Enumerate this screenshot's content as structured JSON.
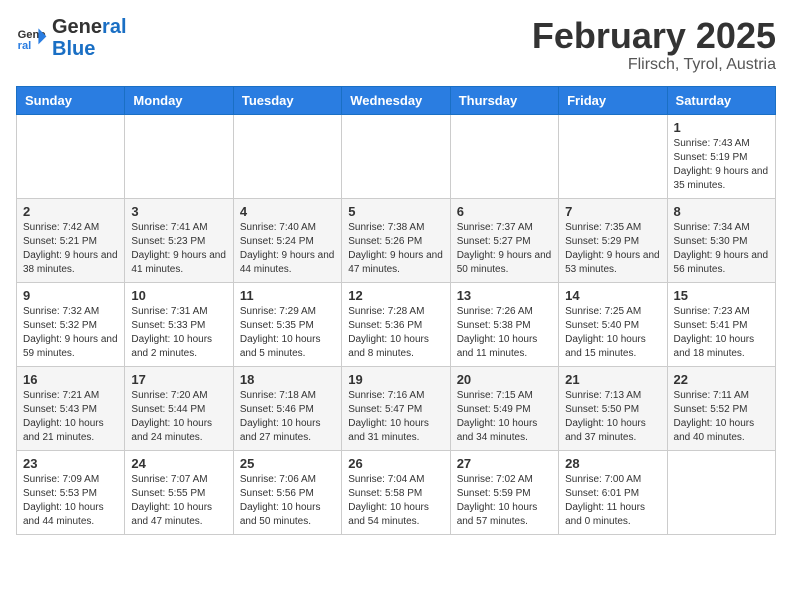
{
  "header": {
    "logo_line1": "General",
    "logo_line2": "Blue",
    "month_title": "February 2025",
    "location": "Flirsch, Tyrol, Austria"
  },
  "days_of_week": [
    "Sunday",
    "Monday",
    "Tuesday",
    "Wednesday",
    "Thursday",
    "Friday",
    "Saturday"
  ],
  "weeks": [
    [
      {
        "day": "",
        "detail": ""
      },
      {
        "day": "",
        "detail": ""
      },
      {
        "day": "",
        "detail": ""
      },
      {
        "day": "",
        "detail": ""
      },
      {
        "day": "",
        "detail": ""
      },
      {
        "day": "",
        "detail": ""
      },
      {
        "day": "1",
        "detail": "Sunrise: 7:43 AM\nSunset: 5:19 PM\nDaylight: 9 hours and 35 minutes."
      }
    ],
    [
      {
        "day": "2",
        "detail": "Sunrise: 7:42 AM\nSunset: 5:21 PM\nDaylight: 9 hours and 38 minutes."
      },
      {
        "day": "3",
        "detail": "Sunrise: 7:41 AM\nSunset: 5:23 PM\nDaylight: 9 hours and 41 minutes."
      },
      {
        "day": "4",
        "detail": "Sunrise: 7:40 AM\nSunset: 5:24 PM\nDaylight: 9 hours and 44 minutes."
      },
      {
        "day": "5",
        "detail": "Sunrise: 7:38 AM\nSunset: 5:26 PM\nDaylight: 9 hours and 47 minutes."
      },
      {
        "day": "6",
        "detail": "Sunrise: 7:37 AM\nSunset: 5:27 PM\nDaylight: 9 hours and 50 minutes."
      },
      {
        "day": "7",
        "detail": "Sunrise: 7:35 AM\nSunset: 5:29 PM\nDaylight: 9 hours and 53 minutes."
      },
      {
        "day": "8",
        "detail": "Sunrise: 7:34 AM\nSunset: 5:30 PM\nDaylight: 9 hours and 56 minutes."
      }
    ],
    [
      {
        "day": "9",
        "detail": "Sunrise: 7:32 AM\nSunset: 5:32 PM\nDaylight: 9 hours and 59 minutes."
      },
      {
        "day": "10",
        "detail": "Sunrise: 7:31 AM\nSunset: 5:33 PM\nDaylight: 10 hours and 2 minutes."
      },
      {
        "day": "11",
        "detail": "Sunrise: 7:29 AM\nSunset: 5:35 PM\nDaylight: 10 hours and 5 minutes."
      },
      {
        "day": "12",
        "detail": "Sunrise: 7:28 AM\nSunset: 5:36 PM\nDaylight: 10 hours and 8 minutes."
      },
      {
        "day": "13",
        "detail": "Sunrise: 7:26 AM\nSunset: 5:38 PM\nDaylight: 10 hours and 11 minutes."
      },
      {
        "day": "14",
        "detail": "Sunrise: 7:25 AM\nSunset: 5:40 PM\nDaylight: 10 hours and 15 minutes."
      },
      {
        "day": "15",
        "detail": "Sunrise: 7:23 AM\nSunset: 5:41 PM\nDaylight: 10 hours and 18 minutes."
      }
    ],
    [
      {
        "day": "16",
        "detail": "Sunrise: 7:21 AM\nSunset: 5:43 PM\nDaylight: 10 hours and 21 minutes."
      },
      {
        "day": "17",
        "detail": "Sunrise: 7:20 AM\nSunset: 5:44 PM\nDaylight: 10 hours and 24 minutes."
      },
      {
        "day": "18",
        "detail": "Sunrise: 7:18 AM\nSunset: 5:46 PM\nDaylight: 10 hours and 27 minutes."
      },
      {
        "day": "19",
        "detail": "Sunrise: 7:16 AM\nSunset: 5:47 PM\nDaylight: 10 hours and 31 minutes."
      },
      {
        "day": "20",
        "detail": "Sunrise: 7:15 AM\nSunset: 5:49 PM\nDaylight: 10 hours and 34 minutes."
      },
      {
        "day": "21",
        "detail": "Sunrise: 7:13 AM\nSunset: 5:50 PM\nDaylight: 10 hours and 37 minutes."
      },
      {
        "day": "22",
        "detail": "Sunrise: 7:11 AM\nSunset: 5:52 PM\nDaylight: 10 hours and 40 minutes."
      }
    ],
    [
      {
        "day": "23",
        "detail": "Sunrise: 7:09 AM\nSunset: 5:53 PM\nDaylight: 10 hours and 44 minutes."
      },
      {
        "day": "24",
        "detail": "Sunrise: 7:07 AM\nSunset: 5:55 PM\nDaylight: 10 hours and 47 minutes."
      },
      {
        "day": "25",
        "detail": "Sunrise: 7:06 AM\nSunset: 5:56 PM\nDaylight: 10 hours and 50 minutes."
      },
      {
        "day": "26",
        "detail": "Sunrise: 7:04 AM\nSunset: 5:58 PM\nDaylight: 10 hours and 54 minutes."
      },
      {
        "day": "27",
        "detail": "Sunrise: 7:02 AM\nSunset: 5:59 PM\nDaylight: 10 hours and 57 minutes."
      },
      {
        "day": "28",
        "detail": "Sunrise: 7:00 AM\nSunset: 6:01 PM\nDaylight: 11 hours and 0 minutes."
      },
      {
        "day": "",
        "detail": ""
      }
    ]
  ]
}
